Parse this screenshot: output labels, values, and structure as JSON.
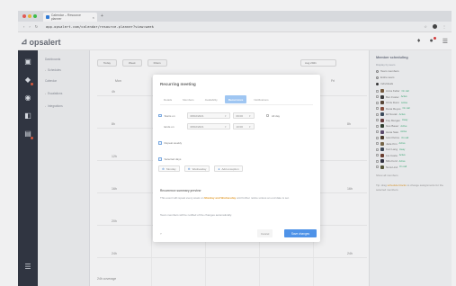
{
  "browser": {
    "tab_title": "Calendar – Resource planner",
    "tab_close": "×",
    "new_tab": "+",
    "nav_back": "‹",
    "nav_forward": "›",
    "nav_reload": "↻",
    "url": "app.opsalert.com/calendar/resource-planner?view=week",
    "star": "☆",
    "menu": "⋮"
  },
  "app": {
    "logo_text": "opsalert",
    "logo_mark": "⊿",
    "header_icons": {
      "bell": "♦",
      "alerts": "●",
      "chat": "☰"
    }
  },
  "rail": {
    "icons": [
      "▣",
      "◆",
      "◉",
      "◧",
      "▤",
      "☰"
    ]
  },
  "nav": {
    "items": [
      {
        "label": "Dashboards",
        "chevron": ""
      },
      {
        "label": "Schedules",
        "chevron": "›"
      },
      {
        "label": "Calendar",
        "chevron": ""
      },
      {
        "label": "Escalations",
        "chevron": "›"
      },
      {
        "label": "Integrations",
        "chevron": "›"
      }
    ]
  },
  "calendar": {
    "toolbar": [
      "Today",
      "Week",
      "Filters"
    ],
    "date": "Aug 2021",
    "days": [
      "Mon",
      "Tue",
      "Wed",
      "Thu",
      "Fri"
    ],
    "marks": [
      {
        "label": "4h"
      },
      {
        "label": "8h"
      },
      {
        "label": "12h"
      },
      {
        "label": "16h"
      },
      {
        "label": "20h"
      },
      {
        "label": "24h"
      }
    ],
    "bottom_label": "24h coverage"
  },
  "right_panel": {
    "title": "Member scheduling",
    "subtitle": "Display by team",
    "options": [
      "Team members",
      "Entire team",
      "Individuals"
    ],
    "options_selected": 2,
    "people": [
      {
        "name": "Anna Keller",
        "tag": "On call",
        "color": "#7a5c3c"
      },
      {
        "name": "Ben Foster",
        "tag": "Active",
        "color": "#3b3b3b"
      },
      {
        "name": "Chris Dunn",
        "tag": "Active",
        "color": "#5a4636"
      },
      {
        "name": "Dana Reyes",
        "tag": "On call",
        "color": "#8c4f3c"
      },
      {
        "name": "Eli Novak",
        "tag": "Active",
        "color": "#3d4d5e"
      },
      {
        "name": "Fay Morgan",
        "tag": "Away",
        "color": "#6a3b3b"
      },
      {
        "name": "Gus Bauer",
        "tag": "Active",
        "color": "#2f3f2f"
      },
      {
        "name": "Hana Sato",
        "tag": "Active",
        "color": "#5e4a6e"
      },
      {
        "name": "Ivan Petrov",
        "tag": "On call",
        "color": "#4b3a2a"
      },
      {
        "name": "Jade Kim",
        "tag": "Active",
        "color": "#7b6a4a"
      },
      {
        "name": "Kurt Lang",
        "tag": "Away",
        "color": "#3f4a5a"
      },
      {
        "name": "Lia Costa",
        "tag": "Active",
        "color": "#6e3e2e"
      },
      {
        "name": "Milo Ford",
        "tag": "Active",
        "color": "#2e2e3e"
      },
      {
        "name": "Nora Lind",
        "tag": "On call",
        "color": "#5a5a3a"
      }
    ],
    "footer": "Show all members",
    "note_pre": "Tip: drag",
    "note_hl": "schedule blocks",
    "note_post": "to change assignments for the selected members."
  },
  "modal": {
    "title": "Recurring meeting",
    "tabs": [
      "Details",
      "Members",
      "Availability",
      "Recurrence",
      "Notifications"
    ],
    "active_tab": 3,
    "row1_label": "Starts on",
    "row1_date": "08/02/2021",
    "row1_time": "09:00",
    "row1_check": "All day",
    "row2_label": "Ends on",
    "row2_date": "08/02/2021",
    "row2_time": "10:00",
    "repeat_label": "Repeat weekly",
    "days_label": "Selected days",
    "btn_a": "Monday",
    "btn_b": "Wednesday",
    "btn_c": "Add exception",
    "section_title": "Recurrence summary preview",
    "text_pre": "This event will repeat every week on",
    "text_hl": "Monday and Wednesday",
    "text_post": "until further notice unless an end date is set.",
    "text2": "Team members will be notified of the changes automatically.",
    "foot_left": "?",
    "cancel": "Cancel",
    "save": "Save changes"
  },
  "colors": {
    "accent": "#4f93e8",
    "tab_active": "#9fc6f2",
    "rail": "#2f3541",
    "highlight": "#e09a2c"
  }
}
